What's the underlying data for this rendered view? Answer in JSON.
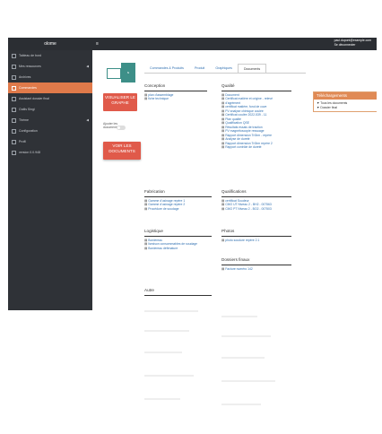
{
  "topbar": {
    "brand": "olome",
    "menu_icon": "≡",
    "user": "paul.dupont@example.com",
    "logout": "Se déconnecter"
  },
  "sidebar": {
    "items": [
      {
        "label": "Tableau de bord",
        "active": false,
        "chevron": false
      },
      {
        "label": "Mes ressources",
        "active": false,
        "chevron": true
      },
      {
        "label": "Archives",
        "active": false,
        "chevron": false
      },
      {
        "label": "Commandes",
        "active": true,
        "chevron": false
      },
      {
        "label": "Assistant dossier final",
        "active": false,
        "chevron": false
      },
      {
        "label": "Outils Singi",
        "active": false,
        "chevron": false
      },
      {
        "label": "Thème",
        "active": false,
        "chevron": true
      },
      {
        "label": "Configuration",
        "active": false,
        "chevron": false
      },
      {
        "label": "Profil",
        "active": false,
        "chevron": false
      },
      {
        "label": "version 0.0.948",
        "active": false,
        "chevron": false
      }
    ]
  },
  "thumb_badge": "s",
  "buttons": {
    "visualize": "VISUALISER LE GRAPHE",
    "show_docs": "VOIR LES DOCUMENTS"
  },
  "toggle_label": "Ajouter les documents",
  "tabs": [
    "Commandes & Produits",
    "Produit",
    "Graphiques",
    "Documents"
  ],
  "sections": {
    "conception": {
      "title": "Conception",
      "links": [
        "plan d'assemblage",
        "fiche technique"
      ]
    },
    "qualite": {
      "title": "Qualité",
      "links": [
        "Document",
        "Certificat matière et origine - relevé",
        "d'agrément",
        "certificat matière, fond de cuve",
        "PV analyse chimique coulée",
        "Certificat coulée 2022-539 - 11",
        "Plan qualité",
        "Qualification QSE",
        "Résultats essais de traction",
        "PV magnétoscopie ressuage",
        "Rapport dimension Tri3rm - repère",
        "Analyse de dureté",
        "Rapport dimension Tri3rm repère 2",
        "Rapport contrôle de dureté"
      ]
    },
    "fabrication": {
      "title": "Fabrication",
      "links": [
        "Gamme d'usinage repère 1",
        "Gamme d'usinage repère 2",
        "Procédure de soudage"
      ]
    },
    "qualifications": {
      "title": "Qualifications",
      "links": [
        "certificat Soudeur",
        "CMO UT Niveau 2 - BH2 - 007563",
        "CMO PT Niveau 2 - BO2 - 007503"
      ]
    },
    "logistique": {
      "title": "Logistique",
      "links": [
        "Bordereau",
        "livraison consommables de soudage",
        "Bordereau défenature"
      ]
    },
    "photos": {
      "title": "Photos",
      "links": [
        "photo soudure repère 2.1"
      ]
    },
    "dossiers": {
      "title": "Dossiers finaux",
      "links": [
        "Facture numéro 142"
      ]
    },
    "autre": {
      "title": "Autre"
    }
  },
  "downloads": {
    "title": "Téléchargements",
    "items": [
      "Tous les documents",
      "Dossier final"
    ]
  },
  "colors": {
    "sidebar_bg": "#2f3237",
    "active": "#e07a4a",
    "accent_red": "#e05a4a",
    "link": "#2f6fb0",
    "download_header": "#e08a55"
  }
}
